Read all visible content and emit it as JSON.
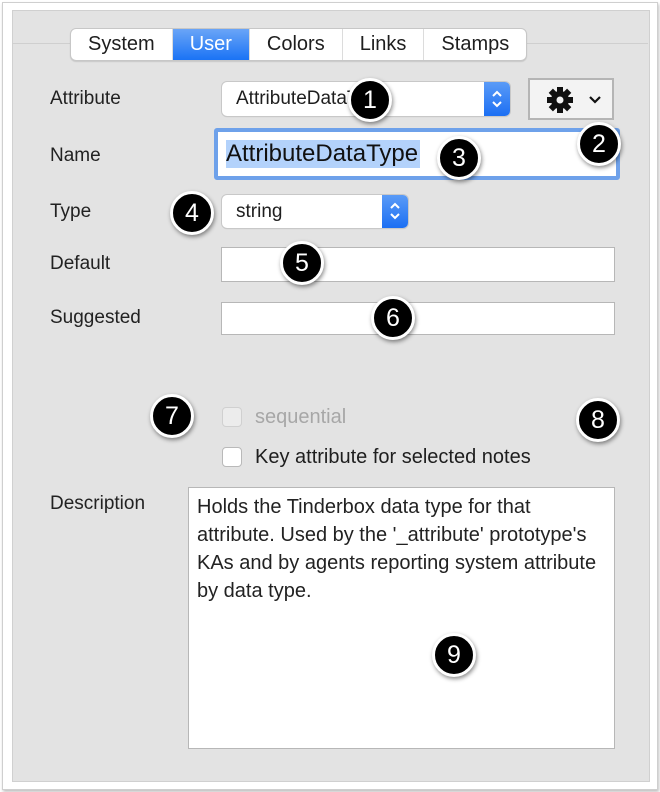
{
  "tabs": [
    {
      "label": "System",
      "active": false
    },
    {
      "label": "User",
      "active": true
    },
    {
      "label": "Colors",
      "active": false
    },
    {
      "label": "Links",
      "active": false
    },
    {
      "label": "Stamps",
      "active": false
    }
  ],
  "attribute": {
    "label": "Attribute",
    "value": "AttributeDataType"
  },
  "gear_button": {
    "icon": "gear-icon",
    "caret": "chevron-down-icon"
  },
  "name": {
    "label": "Name",
    "value": "AttributeDataType"
  },
  "type": {
    "label": "Type",
    "value": "string"
  },
  "default": {
    "label": "Default",
    "value": ""
  },
  "suggested": {
    "label": "Suggested",
    "value": ""
  },
  "sequential": {
    "label": "sequential",
    "checked": false,
    "enabled": false
  },
  "key_attribute": {
    "label": "Key attribute for selected notes",
    "checked": false
  },
  "description": {
    "label": "Description",
    "value": "Holds the Tinderbox data type for that attribute. Used by the '_attribute' prototype's KAs and by agents reporting system attribute by data type."
  },
  "callouts": [
    "1",
    "2",
    "3",
    "4",
    "5",
    "6",
    "7",
    "8",
    "9"
  ],
  "colors": {
    "accent": "#1a73f5",
    "selection": "#b3d2fb",
    "focus_ring": "#6ea1ea",
    "panel": "#e3e3e3"
  }
}
